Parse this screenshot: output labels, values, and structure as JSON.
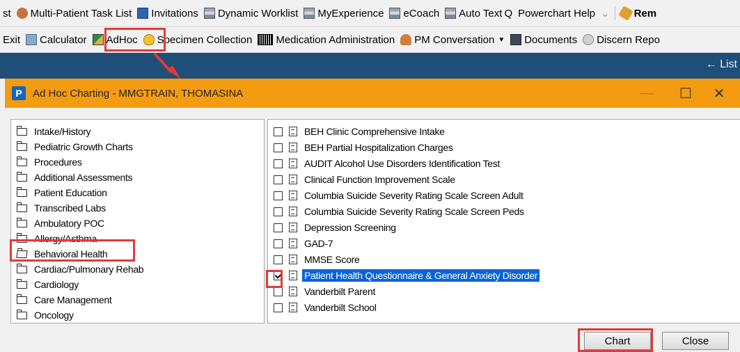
{
  "toolbar1": {
    "items": [
      {
        "label": "st"
      },
      {
        "label": "Multi-Patient Task List"
      },
      {
        "label": "Invitations"
      },
      {
        "label": "Dynamic Worklist"
      },
      {
        "label": "MyExperience"
      },
      {
        "label": "eCoach"
      },
      {
        "label": "Auto Text"
      },
      {
        "label": "Powerchart Help"
      },
      {
        "label": "Rem"
      }
    ]
  },
  "toolbar2": {
    "items": [
      {
        "label": "Exit"
      },
      {
        "label": "Calculator"
      },
      {
        "label": "AdHoc"
      },
      {
        "label": "Specimen Collection"
      },
      {
        "label": "Medication Administration"
      },
      {
        "label": "PM Conversation"
      },
      {
        "label": "Documents"
      },
      {
        "label": "Discern Repo"
      }
    ]
  },
  "bluebar": {
    "list_label": "← List"
  },
  "dialog": {
    "title": "Ad Hoc Charting - MMGTRAIN, THOMASINA",
    "icon_letter": "P",
    "min_glyph": "—",
    "max_glyph": "☐",
    "close_glyph": "✕"
  },
  "tree": {
    "items": [
      {
        "label": "Intake/History"
      },
      {
        "label": "Pediatric Growth Charts"
      },
      {
        "label": "Procedures"
      },
      {
        "label": "Additional Assessments"
      },
      {
        "label": "Patient Education"
      },
      {
        "label": "Transcribed Labs"
      },
      {
        "label": "Ambulatory POC"
      },
      {
        "label": "Allergy/Asthma"
      },
      {
        "label": "Behavioral Health"
      },
      {
        "label": "Cardiac/Pulmonary Rehab"
      },
      {
        "label": "Cardiology"
      },
      {
        "label": "Care Management"
      },
      {
        "label": "Oncology"
      }
    ]
  },
  "forms": {
    "items": [
      {
        "label": "BEH Clinic Comprehensive Intake",
        "checked": false
      },
      {
        "label": "BEH Partial Hospitalization Charges",
        "checked": false
      },
      {
        "label": "AUDIT Alcohol Use Disorders Identification Test",
        "checked": false
      },
      {
        "label": "Clinical Function Improvement Scale",
        "checked": false
      },
      {
        "label": "Columbia Suicide Severity Rating Scale Screen Adult",
        "checked": false
      },
      {
        "label": "Columbia Suicide Severity Rating Scale Screen Peds",
        "checked": false
      },
      {
        "label": "Depression Screening",
        "checked": false
      },
      {
        "label": "GAD-7",
        "checked": false
      },
      {
        "label": "MMSE Score",
        "checked": false
      },
      {
        "label": "Patient Health Questionnaire & General Anxiety Disorder",
        "checked": true
      },
      {
        "label": "Vanderbilt Parent",
        "checked": false
      },
      {
        "label": "Vanderbilt School",
        "checked": false
      }
    ]
  },
  "buttons": {
    "chart": "Chart",
    "close": "Close"
  },
  "colors": {
    "accent_orange": "#f39c12",
    "nav_blue": "#1f4e79",
    "highlight_red": "#e03a3a",
    "selection_blue": "#0a64d6"
  }
}
